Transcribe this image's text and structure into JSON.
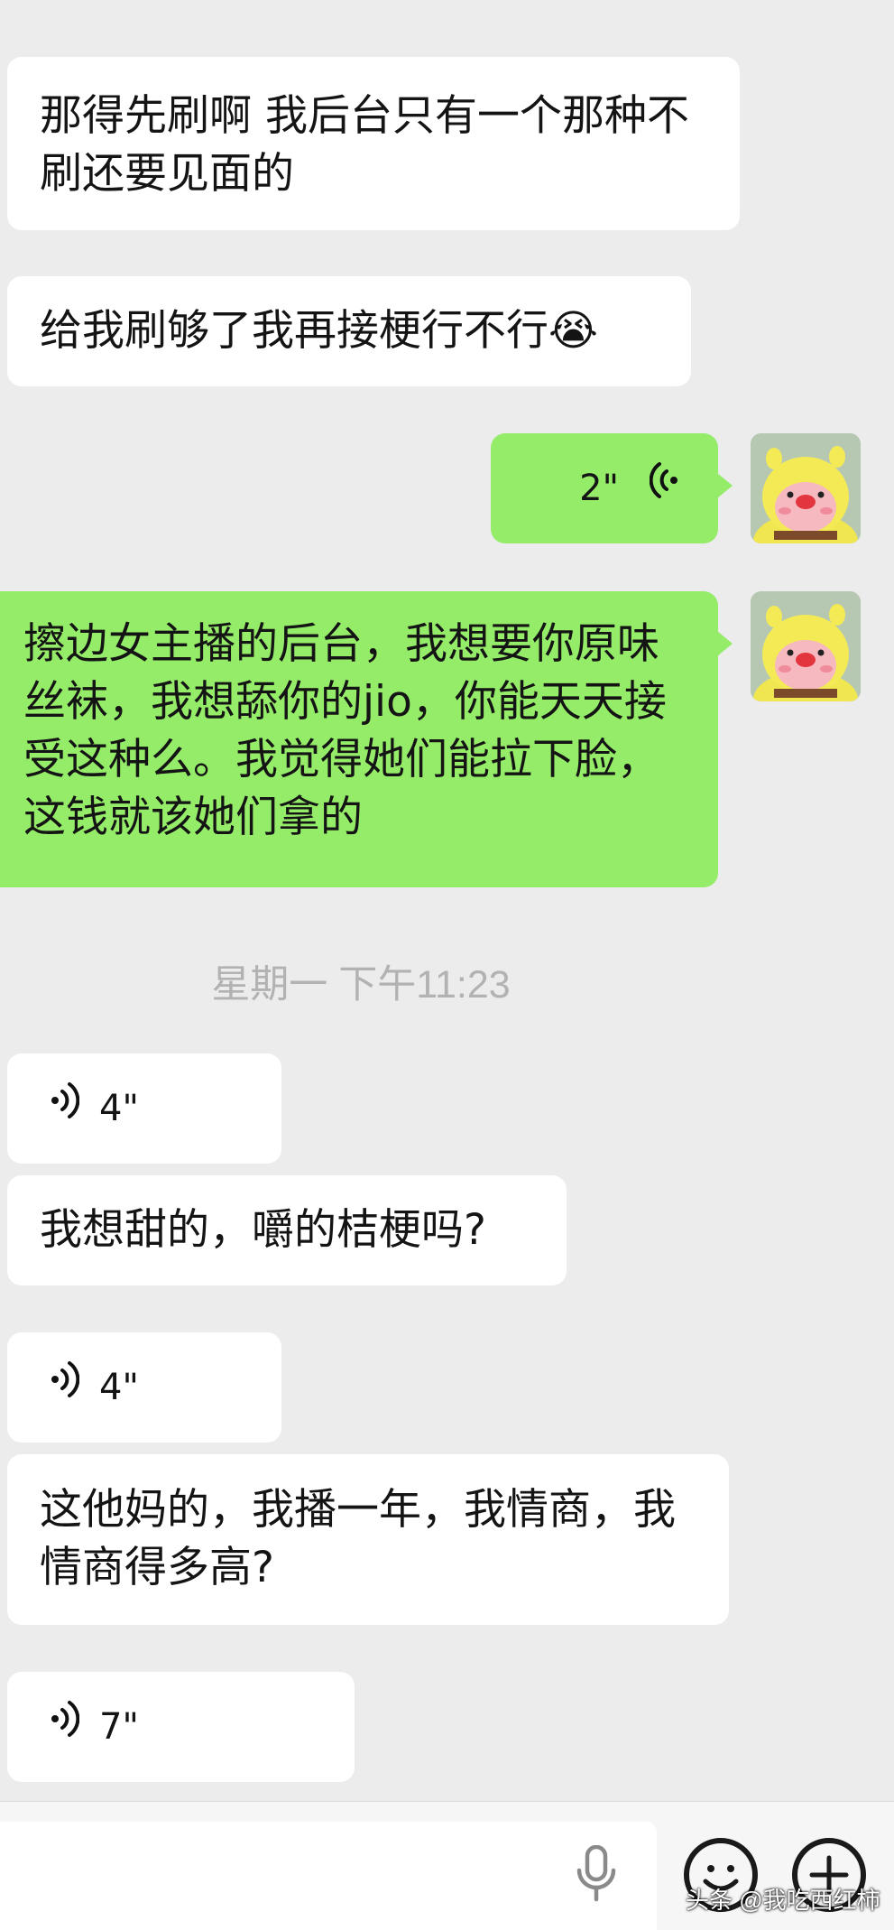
{
  "messages": [
    {
      "side": "incoming",
      "type": "text",
      "text": "那得先刷啊 我后台只有一个那种不刷还要见面的"
    },
    {
      "side": "incoming",
      "type": "text",
      "text": "给我刷够了我再接梗行不行😭"
    },
    {
      "side": "outgoing",
      "type": "voice",
      "duration": "2\""
    },
    {
      "side": "outgoing",
      "type": "text",
      "text": "擦边女主播的后台，我想要你原味丝袜，我想舔你的jio，你能天天接受这种么。我觉得她们能拉下脸，这钱就该她们拿的"
    },
    {
      "side": "incoming",
      "type": "voice",
      "duration": "4\""
    },
    {
      "side": "incoming",
      "type": "text",
      "text": "我想甜的，嚼的桔梗吗?"
    },
    {
      "side": "incoming",
      "type": "voice",
      "duration": "4\""
    },
    {
      "side": "incoming",
      "type": "text",
      "text": "这他妈的，我播一年，我情商，我情商得多高?"
    },
    {
      "side": "incoming",
      "type": "voice",
      "duration": "7\""
    }
  ],
  "timestamp": "星期一 下午11:23",
  "icons": {
    "voice": "voice-wave-icon",
    "mic": "microphone-icon",
    "emoji": "emoji-icon",
    "plus": "plus-icon"
  },
  "colors": {
    "background": "#ececec",
    "incoming_bubble": "#ffffff",
    "outgoing_bubble": "#95ec69",
    "timestamp": "#b2b2b2"
  },
  "watermark": "头条 @我吃西红柿"
}
